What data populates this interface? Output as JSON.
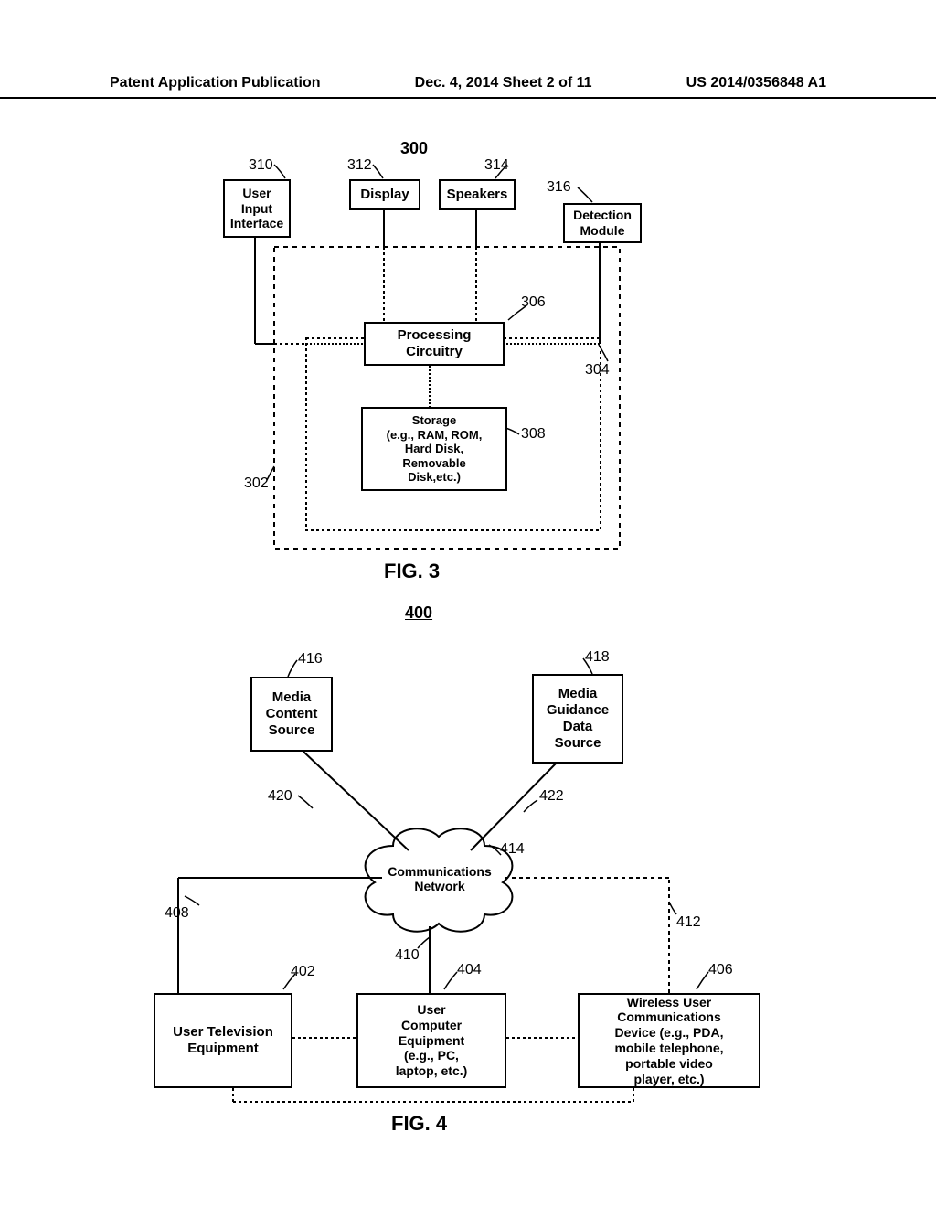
{
  "header": {
    "left": "Patent Application Publication",
    "center": "Dec. 4, 2014  Sheet 2 of 11",
    "right": "US 2014/0356848 A1"
  },
  "fig3": {
    "ref": "300",
    "caption": "FIG. 3",
    "boxes": {
      "user_input": "User\nInput\nInterface",
      "display": "Display",
      "speakers": "Speakers",
      "detection": "Detection\nModule",
      "processing": "Processing\nCircuitry",
      "storage": "Storage\n(e.g., RAM, ROM,\nHard Disk,\nRemovable\nDisk,etc.)"
    },
    "labels": {
      "n300": "300",
      "n302": "302",
      "n304": "304",
      "n306": "306",
      "n308": "308",
      "n310": "310",
      "n312": "312",
      "n314": "314",
      "n316": "316"
    }
  },
  "fig4": {
    "ref": "400",
    "caption": "FIG. 4",
    "boxes": {
      "media_content": "Media\nContent\nSource",
      "media_guidance": "Media\nGuidance\nData\nSource",
      "comm_network": "Communications\nNetwork",
      "user_tv": "User Television\nEquipment",
      "user_computer": "User\nComputer\nEquipment\n(e.g., PC,\nlaptop, etc.)",
      "wireless": "Wireless User\nCommunications\nDevice (e.g., PDA,\nmobile telephone,\nportable video\nplayer, etc.)"
    },
    "labels": {
      "n400": "400",
      "n402": "402",
      "n404": "404",
      "n406": "406",
      "n408": "408",
      "n410": "410",
      "n412": "412",
      "n414": "414",
      "n416": "416",
      "n418": "418",
      "n420": "420",
      "n422": "422"
    }
  }
}
